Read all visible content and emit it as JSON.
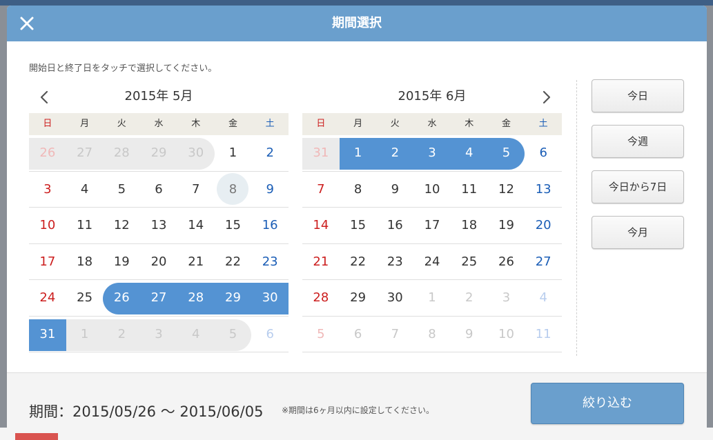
{
  "modal": {
    "title": "期間選択",
    "instruction": "開始日と終了日をタッチで選択してください。"
  },
  "weekdays": [
    "日",
    "月",
    "火",
    "水",
    "木",
    "金",
    "土"
  ],
  "calendars": [
    {
      "title": "2015年 5月",
      "weeks": [
        [
          {
            "d": "26",
            "out": true
          },
          {
            "d": "27",
            "out": true
          },
          {
            "d": "28",
            "out": true
          },
          {
            "d": "29",
            "out": true
          },
          {
            "d": "30",
            "out": true
          },
          {
            "d": "1"
          },
          {
            "d": "2"
          }
        ],
        [
          {
            "d": "3"
          },
          {
            "d": "4"
          },
          {
            "d": "5"
          },
          {
            "d": "6"
          },
          {
            "d": "7"
          },
          {
            "d": "8",
            "today": true
          },
          {
            "d": "9"
          }
        ],
        [
          {
            "d": "10"
          },
          {
            "d": "11"
          },
          {
            "d": "12"
          },
          {
            "d": "13"
          },
          {
            "d": "14"
          },
          {
            "d": "15"
          },
          {
            "d": "16"
          }
        ],
        [
          {
            "d": "17"
          },
          {
            "d": "18"
          },
          {
            "d": "19"
          },
          {
            "d": "20"
          },
          {
            "d": "21"
          },
          {
            "d": "22"
          },
          {
            "d": "23"
          }
        ],
        [
          {
            "d": "24"
          },
          {
            "d": "25"
          },
          {
            "d": "26",
            "sel": true
          },
          {
            "d": "27",
            "sel": true
          },
          {
            "d": "28",
            "sel": true
          },
          {
            "d": "29",
            "sel": true
          },
          {
            "d": "30",
            "sel": true
          }
        ],
        [
          {
            "d": "31",
            "sel": true
          },
          {
            "d": "1",
            "out": true
          },
          {
            "d": "2",
            "out": true
          },
          {
            "d": "3",
            "out": true
          },
          {
            "d": "4",
            "out": true
          },
          {
            "d": "5",
            "out": true
          },
          {
            "d": "6",
            "out": true
          }
        ]
      ]
    },
    {
      "title": "2015年 6月",
      "weeks": [
        [
          {
            "d": "31",
            "out": true
          },
          {
            "d": "1",
            "sel": true
          },
          {
            "d": "2",
            "sel": true
          },
          {
            "d": "3",
            "sel": true
          },
          {
            "d": "4",
            "sel": true
          },
          {
            "d": "5",
            "sel": true
          },
          {
            "d": "6"
          }
        ],
        [
          {
            "d": "7"
          },
          {
            "d": "8"
          },
          {
            "d": "9"
          },
          {
            "d": "10"
          },
          {
            "d": "11"
          },
          {
            "d": "12"
          },
          {
            "d": "13"
          }
        ],
        [
          {
            "d": "14"
          },
          {
            "d": "15"
          },
          {
            "d": "16"
          },
          {
            "d": "17"
          },
          {
            "d": "18"
          },
          {
            "d": "19"
          },
          {
            "d": "20"
          }
        ],
        [
          {
            "d": "21"
          },
          {
            "d": "22"
          },
          {
            "d": "23"
          },
          {
            "d": "24"
          },
          {
            "d": "25"
          },
          {
            "d": "26"
          },
          {
            "d": "27"
          }
        ],
        [
          {
            "d": "28"
          },
          {
            "d": "29"
          },
          {
            "d": "30"
          },
          {
            "d": "1",
            "out": true
          },
          {
            "d": "2",
            "out": true
          },
          {
            "d": "3",
            "out": true
          },
          {
            "d": "4",
            "out": true
          }
        ],
        [
          {
            "d": "5",
            "out": true
          },
          {
            "d": "6",
            "out": true
          },
          {
            "d": "7",
            "out": true
          },
          {
            "d": "8",
            "out": true
          },
          {
            "d": "9",
            "out": true
          },
          {
            "d": "10",
            "out": true
          },
          {
            "d": "11",
            "out": true
          }
        ]
      ]
    }
  ],
  "quick_buttons": {
    "today": "今日",
    "this_week": "今週",
    "seven_days": "今日から7日",
    "this_month": "今月"
  },
  "footer": {
    "period": "期間：2015/05/26 〜 2015/06/05",
    "note": "※期間は6ヶ月以内に設定してください。",
    "apply_label": "絞り込む"
  },
  "colors": {
    "header": "#6a9fcd",
    "selection": "#5493d3",
    "sunday": "#cc1e1e",
    "saturday": "#1a5db6"
  },
  "icons": {
    "close": "close-icon",
    "prev": "chevron-left-icon",
    "next": "chevron-right-icon"
  }
}
